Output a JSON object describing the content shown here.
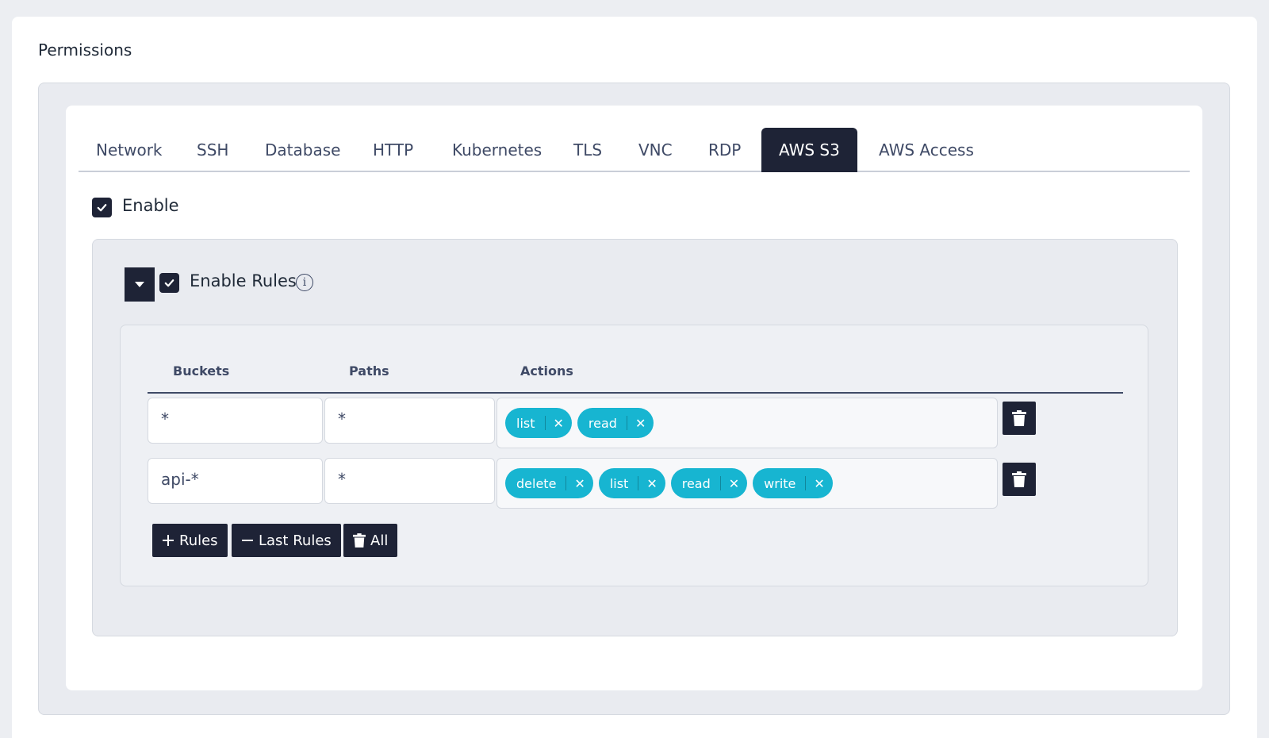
{
  "section": {
    "title": "Permissions"
  },
  "tabs": [
    {
      "label": "Network"
    },
    {
      "label": "SSH"
    },
    {
      "label": "Database"
    },
    {
      "label": "HTTP"
    },
    {
      "label": "Kubernetes"
    },
    {
      "label": "TLS"
    },
    {
      "label": "VNC"
    },
    {
      "label": "RDP"
    },
    {
      "label": "AWS S3",
      "active": true
    },
    {
      "label": "AWS Access"
    }
  ],
  "enable": {
    "label": "Enable",
    "checked": true
  },
  "rules": {
    "label": "Enable Rules",
    "checked": true,
    "info_icon": "info-icon",
    "headers": {
      "buckets": "Buckets",
      "paths": "Paths",
      "actions": "Actions"
    },
    "rows": [
      {
        "bucket": "*",
        "path": "*",
        "actions": [
          "list",
          "read"
        ]
      },
      {
        "bucket": "api-*",
        "path": "*",
        "actions": [
          "delete",
          "list",
          "read",
          "write"
        ]
      }
    ],
    "buttons": {
      "add": "Rules",
      "remove_last": "Last Rules",
      "delete_all": "All"
    }
  },
  "colors": {
    "accent_dark": "#1e2336",
    "chip": "#17b5d1",
    "text_muted": "#3f4a66"
  }
}
